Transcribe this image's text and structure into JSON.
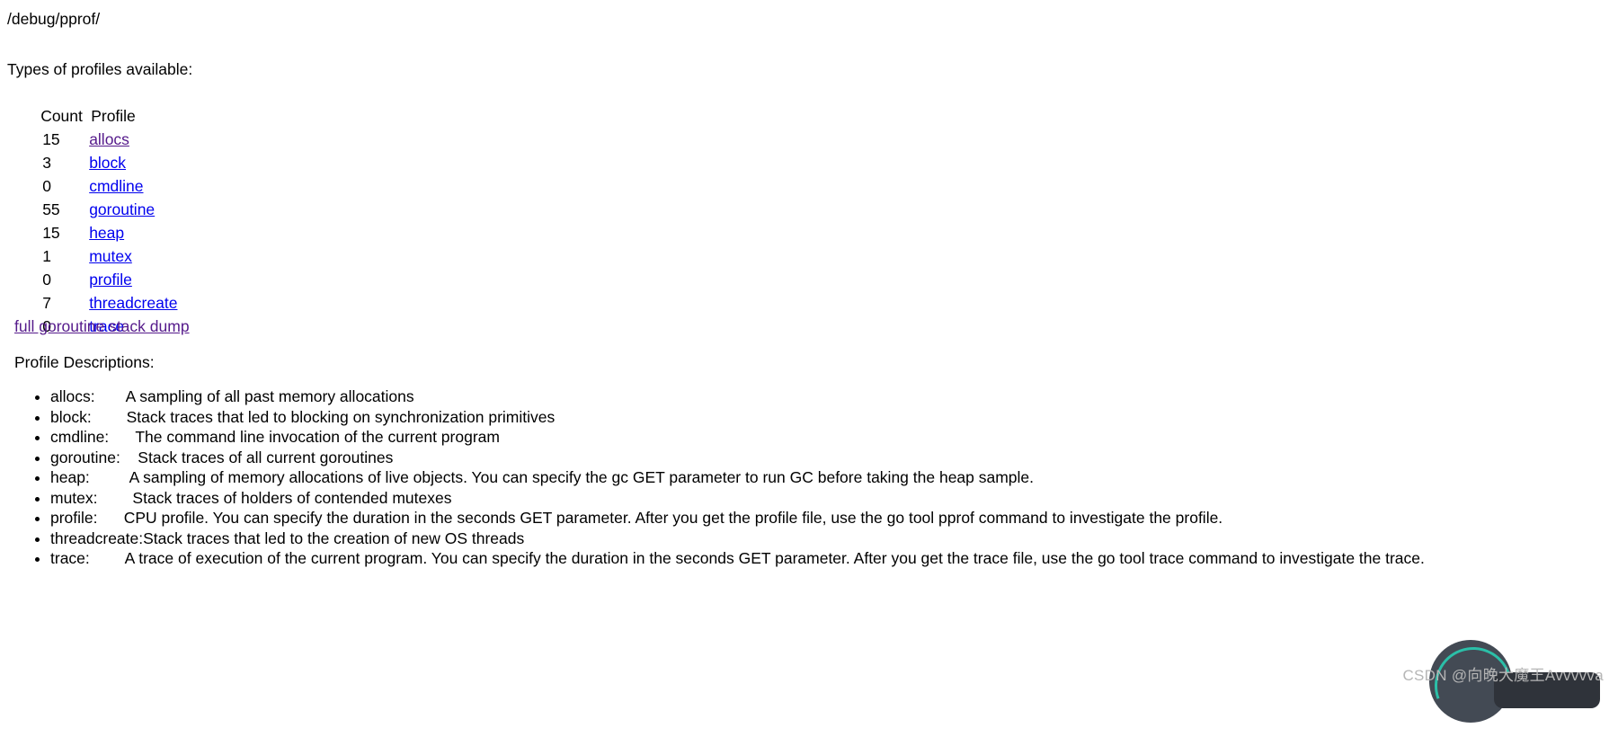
{
  "page": {
    "path_heading": "/debug/pprof/",
    "types_heading": "Types of profiles available:",
    "descriptions_heading": "Profile Descriptions:"
  },
  "profile_table": {
    "header": {
      "count": "Count",
      "profile": "Profile"
    },
    "rows": [
      {
        "count": "15",
        "name": "allocs",
        "visited": true
      },
      {
        "count": "3",
        "name": "block",
        "visited": false
      },
      {
        "count": "0",
        "name": "cmdline",
        "visited": false
      },
      {
        "count": "55",
        "name": "goroutine",
        "visited": false
      },
      {
        "count": "15",
        "name": "heap",
        "visited": false
      },
      {
        "count": "1",
        "name": "mutex",
        "visited": false
      },
      {
        "count": "0",
        "name": "profile",
        "visited": false
      },
      {
        "count": "7",
        "name": "threadcreate",
        "visited": false
      },
      {
        "count": "0",
        "name": "trace",
        "visited": false
      }
    ],
    "full_dump_link": "full goroutine stack dump"
  },
  "descriptions": [
    {
      "name": "alloc_label",
      "label": "allocs:       ",
      "text": "A sampling of all past memory allocations"
    },
    {
      "name": "block_label",
      "label": "block:        ",
      "text": "Stack traces that led to blocking on synchronization primitives"
    },
    {
      "name": "cmdline_label",
      "label": "cmdline:      ",
      "text": "The command line invocation of the current program"
    },
    {
      "name": "goroutine_label",
      "label": "goroutine:    ",
      "text": "Stack traces of all current goroutines"
    },
    {
      "name": "heap_label",
      "label": "heap:         ",
      "text": "A sampling of memory allocations of live objects. You can specify the gc GET parameter to run GC before taking the heap sample."
    },
    {
      "name": "mutex_label",
      "label": "mutex:        ",
      "text": "Stack traces of holders of contended mutexes"
    },
    {
      "name": "profile_label",
      "label": "profile:      ",
      "text": "CPU profile. You can specify the duration in the seconds GET parameter. After you get the profile file, use the go tool pprof command to investigate the profile."
    },
    {
      "name": "threadcreate_label",
      "label": "threadcreate:",
      "text": "Stack traces that led to the creation of new OS threads"
    },
    {
      "name": "trace_label",
      "label": "trace:        ",
      "text": "A trace of execution of the current program. You can specify the duration in the seconds GET parameter. After you get the trace file, use the go tool trace command to investigate the trace."
    }
  ],
  "watermark": {
    "text": "CSDN @向晚大魔王Avvvvva"
  },
  "colors": {
    "link": "#0000ee",
    "visited_link": "#551a8b",
    "text": "#000000",
    "background": "#ffffff",
    "watermark": "#b6b6b6"
  }
}
